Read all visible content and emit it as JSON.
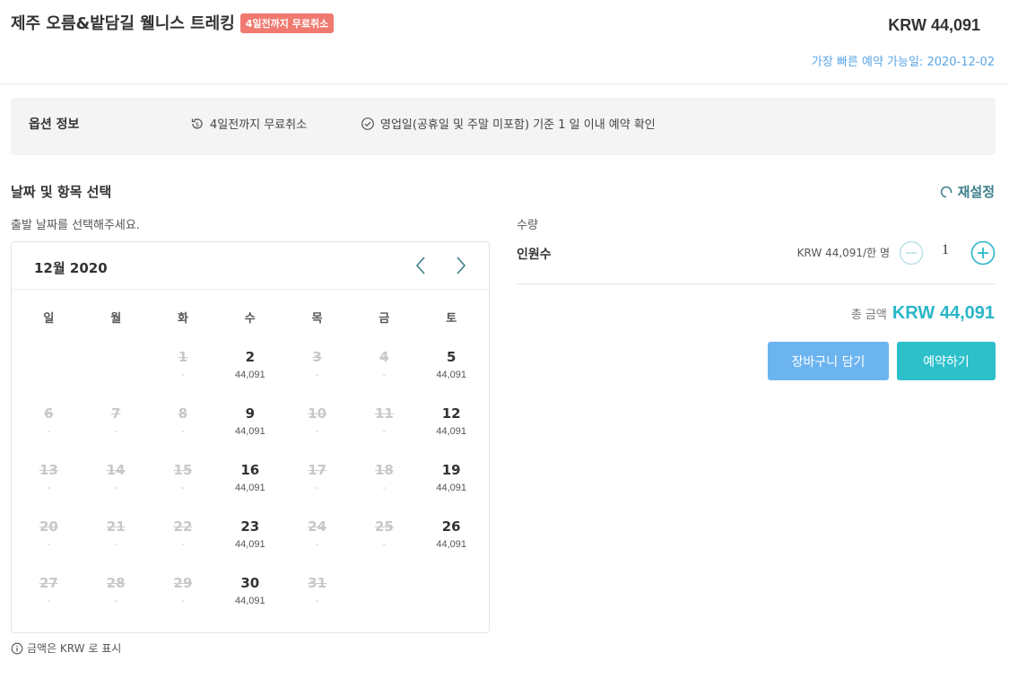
{
  "header": {
    "title": "제주 오름&밭담길 웰니스 트레킹",
    "badge": "4일전까지 무료취소",
    "price": "KRW 44,091",
    "earliest_booking": "가장 빠른 예약 가능일: 2020-12-02"
  },
  "options": {
    "title": "옵션 정보",
    "items": [
      {
        "icon": "refund-icon",
        "label": "4일전까지 무료취소"
      },
      {
        "icon": "check-circle-icon",
        "label": "영업일(공휴일 및 주말 미포함) 기준 1 일 이내 예약 확인"
      }
    ]
  },
  "selection": {
    "title": "날짜 및 항목 선택",
    "reset": "재설정",
    "choose_date": "출발 날짜를 선택해주세요."
  },
  "calendar": {
    "month_label": "12월 2020",
    "weekdays": [
      "일",
      "월",
      "화",
      "수",
      "목",
      "금",
      "토"
    ],
    "leading_blanks": 2,
    "days": [
      {
        "day": "1",
        "price": "-",
        "available": false
      },
      {
        "day": "2",
        "price": "44,091",
        "available": true
      },
      {
        "day": "3",
        "price": "-",
        "available": false
      },
      {
        "day": "4",
        "price": "-",
        "available": false
      },
      {
        "day": "5",
        "price": "44,091",
        "available": true
      },
      {
        "day": "6",
        "price": "-",
        "available": false
      },
      {
        "day": "7",
        "price": "-",
        "available": false
      },
      {
        "day": "8",
        "price": "-",
        "available": false
      },
      {
        "day": "9",
        "price": "44,091",
        "available": true
      },
      {
        "day": "10",
        "price": "-",
        "available": false
      },
      {
        "day": "11",
        "price": "-",
        "available": false
      },
      {
        "day": "12",
        "price": "44,091",
        "available": true
      },
      {
        "day": "13",
        "price": "-",
        "available": false
      },
      {
        "day": "14",
        "price": "-",
        "available": false
      },
      {
        "day": "15",
        "price": "-",
        "available": false
      },
      {
        "day": "16",
        "price": "44,091",
        "available": true
      },
      {
        "day": "17",
        "price": "-",
        "available": false
      },
      {
        "day": "18",
        "price": "-",
        "available": false
      },
      {
        "day": "19",
        "price": "44,091",
        "available": true
      },
      {
        "day": "20",
        "price": "-",
        "available": false
      },
      {
        "day": "21",
        "price": "-",
        "available": false
      },
      {
        "day": "22",
        "price": "-",
        "available": false
      },
      {
        "day": "23",
        "price": "44,091",
        "available": true
      },
      {
        "day": "24",
        "price": "-",
        "available": false
      },
      {
        "day": "25",
        "price": "-",
        "available": false
      },
      {
        "day": "26",
        "price": "44,091",
        "available": true
      },
      {
        "day": "27",
        "price": "-",
        "available": false
      },
      {
        "day": "28",
        "price": "-",
        "available": false
      },
      {
        "day": "29",
        "price": "-",
        "available": false
      },
      {
        "day": "30",
        "price": "44,091",
        "available": true
      },
      {
        "day": "31",
        "price": "-",
        "available": false
      }
    ],
    "note": "금액은 KRW 로 표시"
  },
  "quantity": {
    "label": "수량",
    "item_name": "인원수",
    "unit_price": "KRW 44,091/한 명",
    "value": "1"
  },
  "total": {
    "label": "총 금액",
    "amount": "KRW 44,091"
  },
  "buttons": {
    "cart": "장바구니 담기",
    "book": "예약하기"
  },
  "colors": {
    "badge": "#f07970",
    "accent": "#2bb5c8",
    "earliest": "#5aa6e6",
    "cart_button": "#6cb4f0",
    "book_button": "#2dc0cb",
    "disabled_day": "#c8c8c8"
  }
}
